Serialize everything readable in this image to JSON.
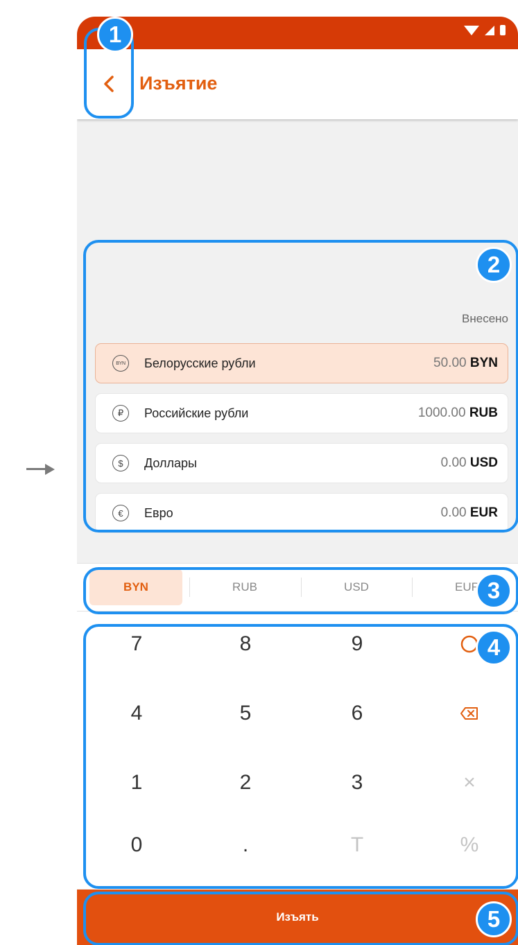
{
  "header": {
    "title": "Изъятие"
  },
  "list": {
    "column_header": "Внесено",
    "items": [
      {
        "icon": "BYN",
        "name": "Белорусские рубли",
        "value": "50.00",
        "code": "BYN",
        "selected": true
      },
      {
        "icon": "₽",
        "name": "Российские рубли",
        "value": "1000.00",
        "code": "RUB",
        "selected": false
      },
      {
        "icon": "$",
        "name": "Доллары",
        "value": "0.00",
        "code": "USD",
        "selected": false
      },
      {
        "icon": "€",
        "name": "Евро",
        "value": "0.00",
        "code": "EUR",
        "selected": false
      }
    ]
  },
  "tabs": [
    "BYN",
    "RUB",
    "USD",
    "EUR"
  ],
  "keypad": {
    "keys": [
      "7",
      "8",
      "9",
      "C",
      "4",
      "5",
      "6",
      "⌫",
      "1",
      "2",
      "3",
      "×",
      "0",
      ".",
      "T",
      "%"
    ]
  },
  "action": {
    "label": "Изъять"
  },
  "callouts": [
    "1",
    "2",
    "3",
    "4",
    "5"
  ],
  "colors": {
    "accent": "#e25f10",
    "statusbar": "#d63a06",
    "callout": "#1e90f0",
    "selected_bg": "#fde4d6"
  },
  "icons": {
    "back": "chevron-left-icon",
    "backspace": "backspace-icon",
    "clear": "clear-icon",
    "multiply": "multiply-icon"
  }
}
